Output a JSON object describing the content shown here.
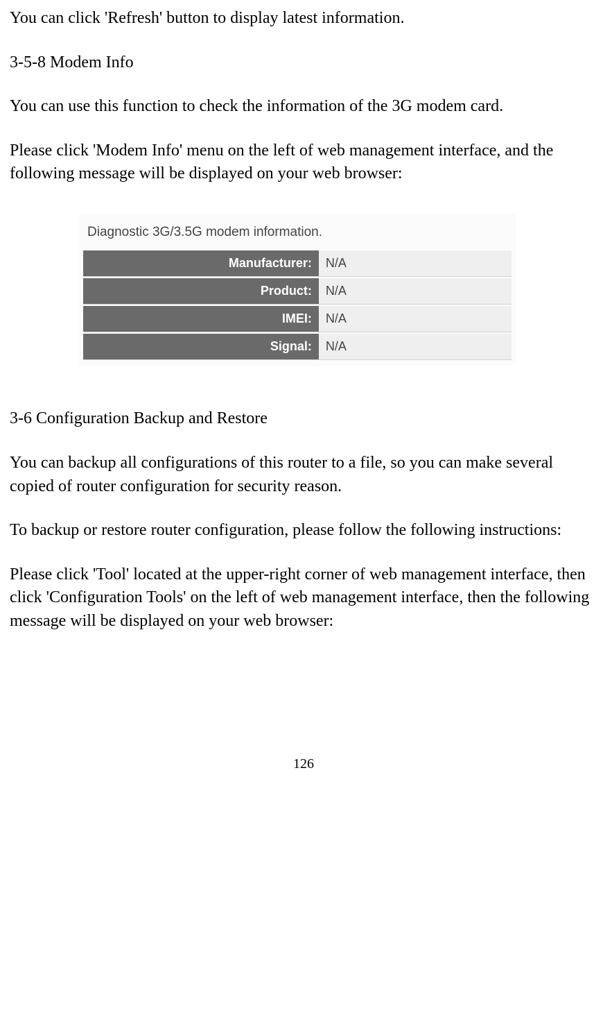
{
  "intro_line": "You can click 'Refresh' button to display latest information.",
  "section_358": {
    "heading": "3-5-8 Modem Info",
    "para1": "You can use this function to check the information of the 3G modem card.",
    "para2": "Please click 'Modem Info' menu on the left of web management interface, and the following message will be displayed on your web browser:"
  },
  "modem_info_box": {
    "title": "Diagnostic 3G/3.5G modem information.",
    "rows": [
      {
        "label": "Manufacturer:",
        "value": "N/A"
      },
      {
        "label": "Product:",
        "value": "N/A"
      },
      {
        "label": "IMEI:",
        "value": "N/A"
      },
      {
        "label": "Signal:",
        "value": "N/A"
      }
    ]
  },
  "section_36": {
    "heading": "3-6 Configuration Backup and Restore",
    "para1": "You can backup all configurations of this router to a file, so you can make several copied of router configuration for security reason.",
    "para2": "To backup or restore router configuration, please follow the following instructions:",
    "para3": "Please click 'Tool' located at the upper-right corner of web management interface, then click 'Configuration Tools' on the left of web management interface, then the following message will be displayed on your web browser:"
  },
  "page_number": "126"
}
